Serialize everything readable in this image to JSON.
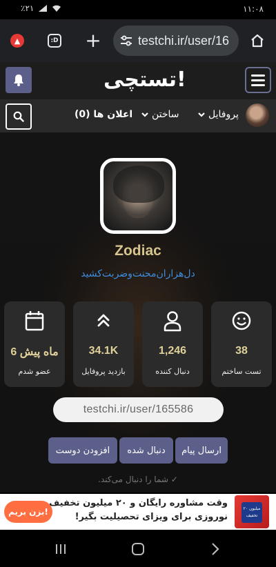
{
  "status_bar": {
    "time": "۱۱:۰۸",
    "battery": "٪۲۱"
  },
  "browser": {
    "url": "testchi.ir/user/16",
    "tab_count_label": ":D"
  },
  "header": {
    "logo_text": "تستچی!"
  },
  "nav": {
    "profile_label": "پروفایل",
    "build_label": "ساختن",
    "notifications_label": "اعلان ها (0)"
  },
  "profile": {
    "username": "Zodiac",
    "bio": "دل‌هزاران‌محنت‌وضربت‌کشید",
    "stats": [
      {
        "icon": "smile-icon",
        "value": "38",
        "label": "تست ساختم"
      },
      {
        "icon": "user-icon",
        "value": "1,246",
        "label": "دنبال کننده"
      },
      {
        "icon": "chevrons-up-icon",
        "value": "34.1K",
        "label": "بازدید پروفایل"
      },
      {
        "icon": "calendar-icon",
        "value": "6 ماه پیش",
        "label": "عضو شدم"
      }
    ],
    "profile_url": "testchi.ir/user/165586",
    "actions": {
      "send_message": "ارسال پیام",
      "followed": "دنبال شده",
      "add_friend": "افزودن دوست"
    },
    "follow_note": "شما را دنبال می‌کند."
  },
  "ad": {
    "line1": "وقت مشاوره رایگان و ۲۰ میلیون تخفیف",
    "line2": "نوروزی برای ویزای تحصیلیت بگیر!",
    "cta": "بزن بریم!",
    "badge_text": "۲۰ میلیون تخفیف"
  },
  "colors": {
    "accent": "#5b5f8a",
    "username": "#d6c58f",
    "bio": "#3f8ddb",
    "ad_cta": "#ff6e40"
  }
}
